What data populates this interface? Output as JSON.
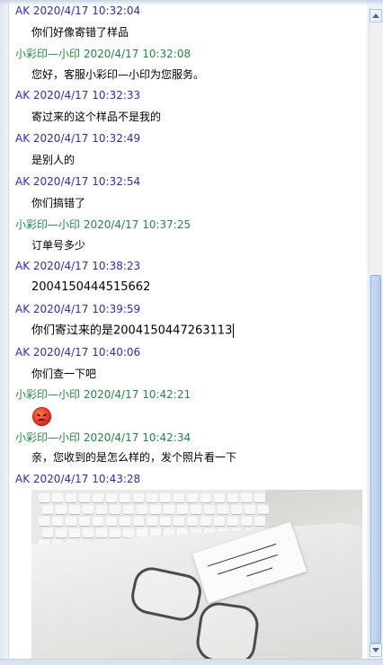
{
  "messages": [
    {
      "sender": "AK",
      "time": "2020/4/17 10:32:04",
      "text": "你们好像寄错了样品",
      "role": "me"
    },
    {
      "sender": "小彩印—小印",
      "time": "2020/4/17 10:32:08",
      "text": "您好，客服小彩印—小印为您服务。",
      "role": "service"
    },
    {
      "sender": "AK",
      "time": "2020/4/17 10:32:33",
      "text": "寄过来的这个样品不是我的",
      "role": "me"
    },
    {
      "sender": "AK",
      "time": "2020/4/17 10:32:49",
      "text": "是别人的",
      "role": "me"
    },
    {
      "sender": "AK",
      "time": "2020/4/17 10:32:54",
      "text": "你们搞错了",
      "role": "me"
    },
    {
      "sender": "小彩印—小印",
      "time": "2020/4/17 10:37:25",
      "text": "订单号多少",
      "role": "service"
    },
    {
      "sender": "AK",
      "time": "2020/4/17 10:38:23",
      "text": "2004150444515662",
      "role": "me"
    },
    {
      "sender": "AK",
      "time": "2020/4/17 10:39:59",
      "text": "你们寄过来的是2004150447263113",
      "role": "me"
    },
    {
      "sender": "AK",
      "time": "2020/4/17 10:40:06",
      "text": "你们查一下吧",
      "role": "me"
    },
    {
      "sender": "小彩印—小印",
      "time": "2020/4/17 10:42:21",
      "text": "",
      "emoji": "angry-face",
      "role": "service"
    },
    {
      "sender": "小彩印—小印",
      "time": "2020/4/17 10:42:34",
      "text": "亲，您收到的是怎么样的，发个照片看一下",
      "role": "service"
    },
    {
      "sender": "AK",
      "time": "2020/4/17 10:43:28",
      "text": "",
      "image": "photo of sample packages on desk",
      "role": "me"
    }
  ],
  "colors": {
    "me": "#2b2bd1",
    "service": "#1f8a3d"
  },
  "icons": {
    "scroll_up": "scroll-up-arrow-icon",
    "scroll_down": "scroll-down-arrow-icon",
    "emoji": "angry-face-icon"
  }
}
